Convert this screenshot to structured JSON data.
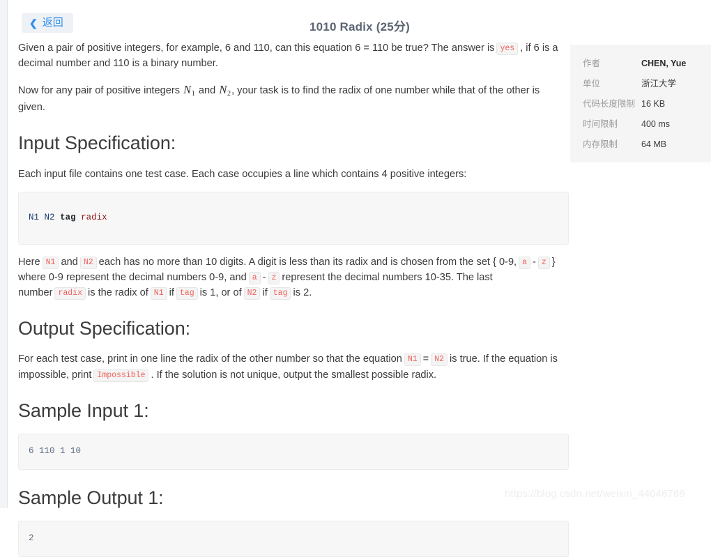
{
  "header": {
    "back_label": "返回",
    "back_icon": "chevron-left-icon",
    "title": "1010 Radix (25分)"
  },
  "info_panel": {
    "rows": [
      {
        "label": "作者",
        "value": "CHEN, Yue",
        "strong": true
      },
      {
        "label": "单位",
        "value": "浙江大学",
        "strong": false
      },
      {
        "label": "代码长度限制",
        "value": "16 KB",
        "strong": false
      },
      {
        "label": "时间限制",
        "value": "400 ms",
        "strong": false
      },
      {
        "label": "内存限制",
        "value": "64 MB",
        "strong": false
      }
    ]
  },
  "content": {
    "intro": {
      "part1": "Given a pair of positive integers, for example, 6 and 110, can this equation 6 = 110 be true? The answer is",
      "code_yes": "yes",
      "part2": ", if 6 is a decimal number and 110 is a binary number."
    },
    "intro2": {
      "part1": "Now for any pair of positive integers",
      "var1": "N",
      "var1_sub": "1",
      "mid": "and",
      "var2": "N",
      "var2_sub": "2",
      "part2": ", your task is to find the radix of one number while that of the other is given."
    },
    "input_spec": {
      "heading": "Input Specification:",
      "paragraph": "Each input file contains one test case. Each case occupies a line which contains 4 positive integers:",
      "code_block": {
        "var1": "N1",
        "var2": "N2",
        "kw": "tag",
        "ident": "radix"
      },
      "detail": {
        "p1": "Here",
        "c_n1": "N1",
        "p2": "and",
        "c_n2": "N2",
        "p3": "each has no more than 10 digits. A digit is less than its radix and is chosen from the set { 0-9,",
        "c_a": "a",
        "p4": "-",
        "c_z": "z",
        "p5": "} where 0-9 represent the decimal numbers 0-9, and",
        "c_a2": "a",
        "p6": "-",
        "c_z2": "z",
        "p7": "represent the decimal numbers 10-35. The last number",
        "c_radix": "radix",
        "p8": "is the radix of",
        "c_n1b": "N1",
        "p9": "if",
        "c_tag": "tag",
        "p10": "is 1, or of",
        "c_n2b": "N2",
        "p11": "if",
        "c_tag2": "tag",
        "p12": "is 2."
      }
    },
    "output_spec": {
      "heading": "Output Specification:",
      "detail": {
        "p1": "For each test case, print in one line the radix of the other number so that the equation",
        "c_n1": "N1",
        "eq": "=",
        "c_n2": "N2",
        "p2": "is true. If the equation is impossible, print",
        "c_imp": "Impossible",
        "p3": ". If the solution is not unique, output the smallest possible radix."
      }
    },
    "sample_input": {
      "heading": "Sample Input 1:",
      "code": "6 110 1 10"
    },
    "sample_output": {
      "heading": "Sample Output 1:",
      "code": "2"
    }
  },
  "watermark": {
    "text": "https://blog.csdn.net/weixin_44046769"
  }
}
